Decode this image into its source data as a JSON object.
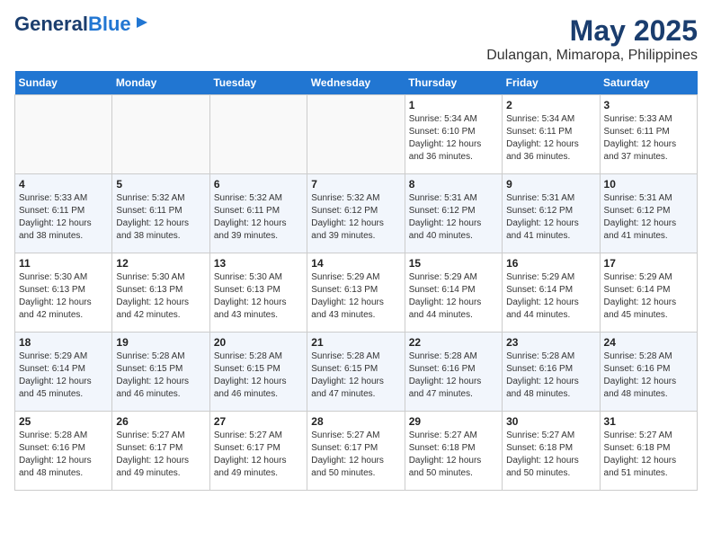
{
  "logo": {
    "line1": "General",
    "line2": "Blue"
  },
  "title": "May 2025",
  "subtitle": "Dulangan, Mimaropa, Philippines",
  "weekdays": [
    "Sunday",
    "Monday",
    "Tuesday",
    "Wednesday",
    "Thursday",
    "Friday",
    "Saturday"
  ],
  "weeks": [
    [
      {
        "day": "",
        "info": ""
      },
      {
        "day": "",
        "info": ""
      },
      {
        "day": "",
        "info": ""
      },
      {
        "day": "",
        "info": ""
      },
      {
        "day": "1",
        "info": "Sunrise: 5:34 AM\nSunset: 6:10 PM\nDaylight: 12 hours\nand 36 minutes."
      },
      {
        "day": "2",
        "info": "Sunrise: 5:34 AM\nSunset: 6:11 PM\nDaylight: 12 hours\nand 36 minutes."
      },
      {
        "day": "3",
        "info": "Sunrise: 5:33 AM\nSunset: 6:11 PM\nDaylight: 12 hours\nand 37 minutes."
      }
    ],
    [
      {
        "day": "4",
        "info": "Sunrise: 5:33 AM\nSunset: 6:11 PM\nDaylight: 12 hours\nand 38 minutes."
      },
      {
        "day": "5",
        "info": "Sunrise: 5:32 AM\nSunset: 6:11 PM\nDaylight: 12 hours\nand 38 minutes."
      },
      {
        "day": "6",
        "info": "Sunrise: 5:32 AM\nSunset: 6:11 PM\nDaylight: 12 hours\nand 39 minutes."
      },
      {
        "day": "7",
        "info": "Sunrise: 5:32 AM\nSunset: 6:12 PM\nDaylight: 12 hours\nand 39 minutes."
      },
      {
        "day": "8",
        "info": "Sunrise: 5:31 AM\nSunset: 6:12 PM\nDaylight: 12 hours\nand 40 minutes."
      },
      {
        "day": "9",
        "info": "Sunrise: 5:31 AM\nSunset: 6:12 PM\nDaylight: 12 hours\nand 41 minutes."
      },
      {
        "day": "10",
        "info": "Sunrise: 5:31 AM\nSunset: 6:12 PM\nDaylight: 12 hours\nand 41 minutes."
      }
    ],
    [
      {
        "day": "11",
        "info": "Sunrise: 5:30 AM\nSunset: 6:13 PM\nDaylight: 12 hours\nand 42 minutes."
      },
      {
        "day": "12",
        "info": "Sunrise: 5:30 AM\nSunset: 6:13 PM\nDaylight: 12 hours\nand 42 minutes."
      },
      {
        "day": "13",
        "info": "Sunrise: 5:30 AM\nSunset: 6:13 PM\nDaylight: 12 hours\nand 43 minutes."
      },
      {
        "day": "14",
        "info": "Sunrise: 5:29 AM\nSunset: 6:13 PM\nDaylight: 12 hours\nand 43 minutes."
      },
      {
        "day": "15",
        "info": "Sunrise: 5:29 AM\nSunset: 6:14 PM\nDaylight: 12 hours\nand 44 minutes."
      },
      {
        "day": "16",
        "info": "Sunrise: 5:29 AM\nSunset: 6:14 PM\nDaylight: 12 hours\nand 44 minutes."
      },
      {
        "day": "17",
        "info": "Sunrise: 5:29 AM\nSunset: 6:14 PM\nDaylight: 12 hours\nand 45 minutes."
      }
    ],
    [
      {
        "day": "18",
        "info": "Sunrise: 5:29 AM\nSunset: 6:14 PM\nDaylight: 12 hours\nand 45 minutes."
      },
      {
        "day": "19",
        "info": "Sunrise: 5:28 AM\nSunset: 6:15 PM\nDaylight: 12 hours\nand 46 minutes."
      },
      {
        "day": "20",
        "info": "Sunrise: 5:28 AM\nSunset: 6:15 PM\nDaylight: 12 hours\nand 46 minutes."
      },
      {
        "day": "21",
        "info": "Sunrise: 5:28 AM\nSunset: 6:15 PM\nDaylight: 12 hours\nand 47 minutes."
      },
      {
        "day": "22",
        "info": "Sunrise: 5:28 AM\nSunset: 6:16 PM\nDaylight: 12 hours\nand 47 minutes."
      },
      {
        "day": "23",
        "info": "Sunrise: 5:28 AM\nSunset: 6:16 PM\nDaylight: 12 hours\nand 48 minutes."
      },
      {
        "day": "24",
        "info": "Sunrise: 5:28 AM\nSunset: 6:16 PM\nDaylight: 12 hours\nand 48 minutes."
      }
    ],
    [
      {
        "day": "25",
        "info": "Sunrise: 5:28 AM\nSunset: 6:16 PM\nDaylight: 12 hours\nand 48 minutes."
      },
      {
        "day": "26",
        "info": "Sunrise: 5:27 AM\nSunset: 6:17 PM\nDaylight: 12 hours\nand 49 minutes."
      },
      {
        "day": "27",
        "info": "Sunrise: 5:27 AM\nSunset: 6:17 PM\nDaylight: 12 hours\nand 49 minutes."
      },
      {
        "day": "28",
        "info": "Sunrise: 5:27 AM\nSunset: 6:17 PM\nDaylight: 12 hours\nand 50 minutes."
      },
      {
        "day": "29",
        "info": "Sunrise: 5:27 AM\nSunset: 6:18 PM\nDaylight: 12 hours\nand 50 minutes."
      },
      {
        "day": "30",
        "info": "Sunrise: 5:27 AM\nSunset: 6:18 PM\nDaylight: 12 hours\nand 50 minutes."
      },
      {
        "day": "31",
        "info": "Sunrise: 5:27 AM\nSunset: 6:18 PM\nDaylight: 12 hours\nand 51 minutes."
      }
    ]
  ]
}
